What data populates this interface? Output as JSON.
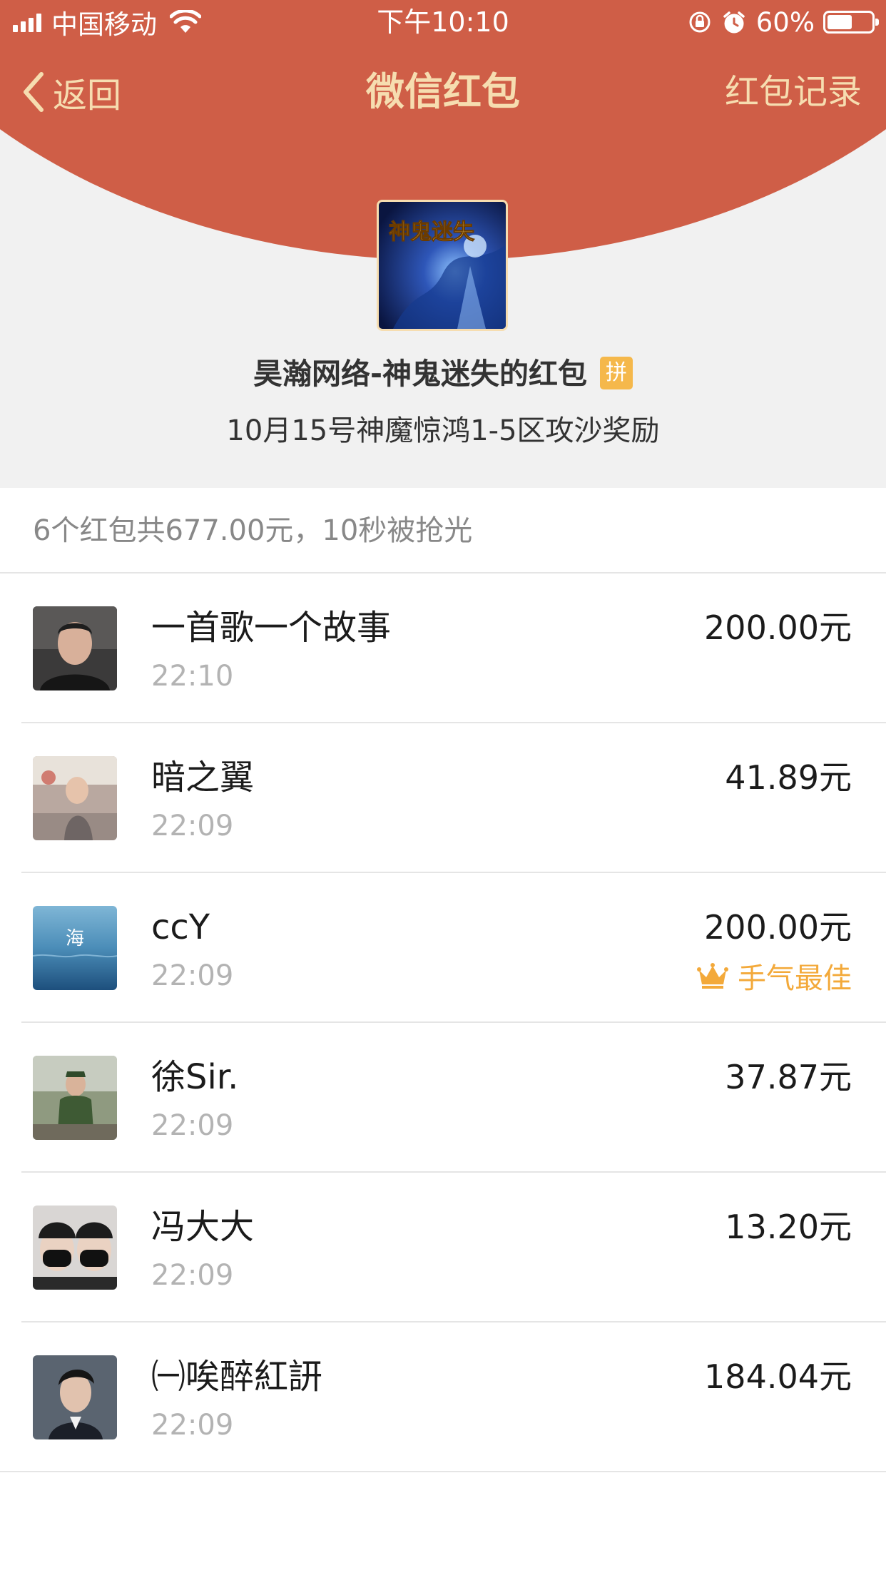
{
  "status_bar": {
    "carrier": "中国移动",
    "time": "下午10:10",
    "battery": "60%",
    "battery_level": 0.6
  },
  "nav": {
    "back_label": "返回",
    "title": "微信红包",
    "record_label": "红包记录"
  },
  "sender": {
    "line": "昊瀚网络-神鬼迷失的红包",
    "badge": "拼",
    "blessing": "10月15号神魔惊鸿1-5区攻沙奖励",
    "avatar_text": "神鬼迷失"
  },
  "summary": "6个红包共677.00元，10秒被抢光",
  "records": [
    {
      "name": "一首歌一个故事",
      "time": "22:10",
      "amount": "200.00元",
      "best": ""
    },
    {
      "name": "暗之翼",
      "time": "22:09",
      "amount": "41.89元",
      "best": ""
    },
    {
      "name": "ccY",
      "time": "22:09",
      "amount": "200.00元",
      "best": "手气最佳",
      "avatar_text": "海"
    },
    {
      "name": "徐Sir.",
      "time": "22:09",
      "amount": "37.87元",
      "best": ""
    },
    {
      "name": "冯大大",
      "time": "22:09",
      "amount": "13.20元",
      "best": ""
    },
    {
      "name": "㈠唉醉紅訮",
      "time": "22:09",
      "amount": "184.04元",
      "best": ""
    }
  ],
  "colors": {
    "header_red": "#cf5e47",
    "header_gold": "#f6ddb0",
    "best_gold": "#f3a93a",
    "badge_yellow": "#f5b84b"
  },
  "icons": {
    "back": "chevron-left-icon",
    "wifi": "wifi-icon",
    "orientation_lock": "orientation-lock-icon",
    "alarm": "alarm-icon",
    "battery": "battery-icon",
    "crown": "crown-icon"
  }
}
